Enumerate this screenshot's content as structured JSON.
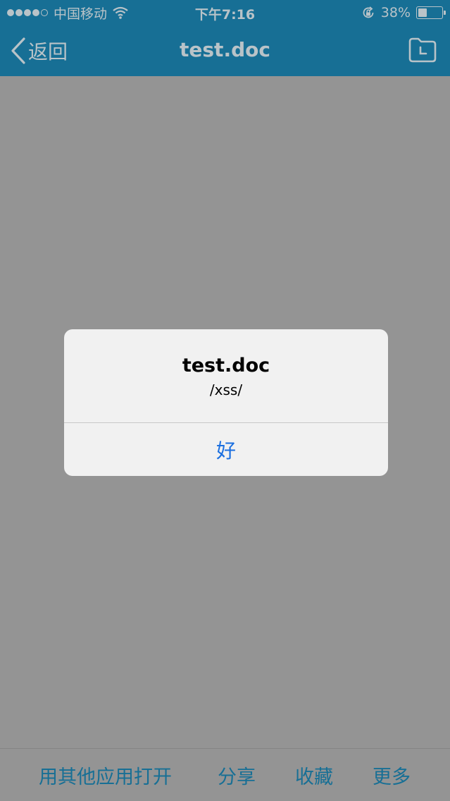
{
  "status_bar": {
    "carrier": "中国移动",
    "time": "下午7:16",
    "battery_percent": "38%",
    "battery_level": 0.38,
    "signal_bars_filled": 4,
    "signal_bars_total": 5
  },
  "nav": {
    "back_label": "返回",
    "title": "test.doc",
    "right_icon": "folder-clock-icon"
  },
  "alert": {
    "title": "test.doc",
    "message": "/xss/",
    "ok_label": "好"
  },
  "toolbar": {
    "open_with": "用其他应用打开",
    "share": "分享",
    "favorite": "收藏",
    "more": "更多"
  },
  "colors": {
    "nav_background": "#176f95",
    "overlay_background": "#949494",
    "alert_button": "#1a6fe0"
  }
}
